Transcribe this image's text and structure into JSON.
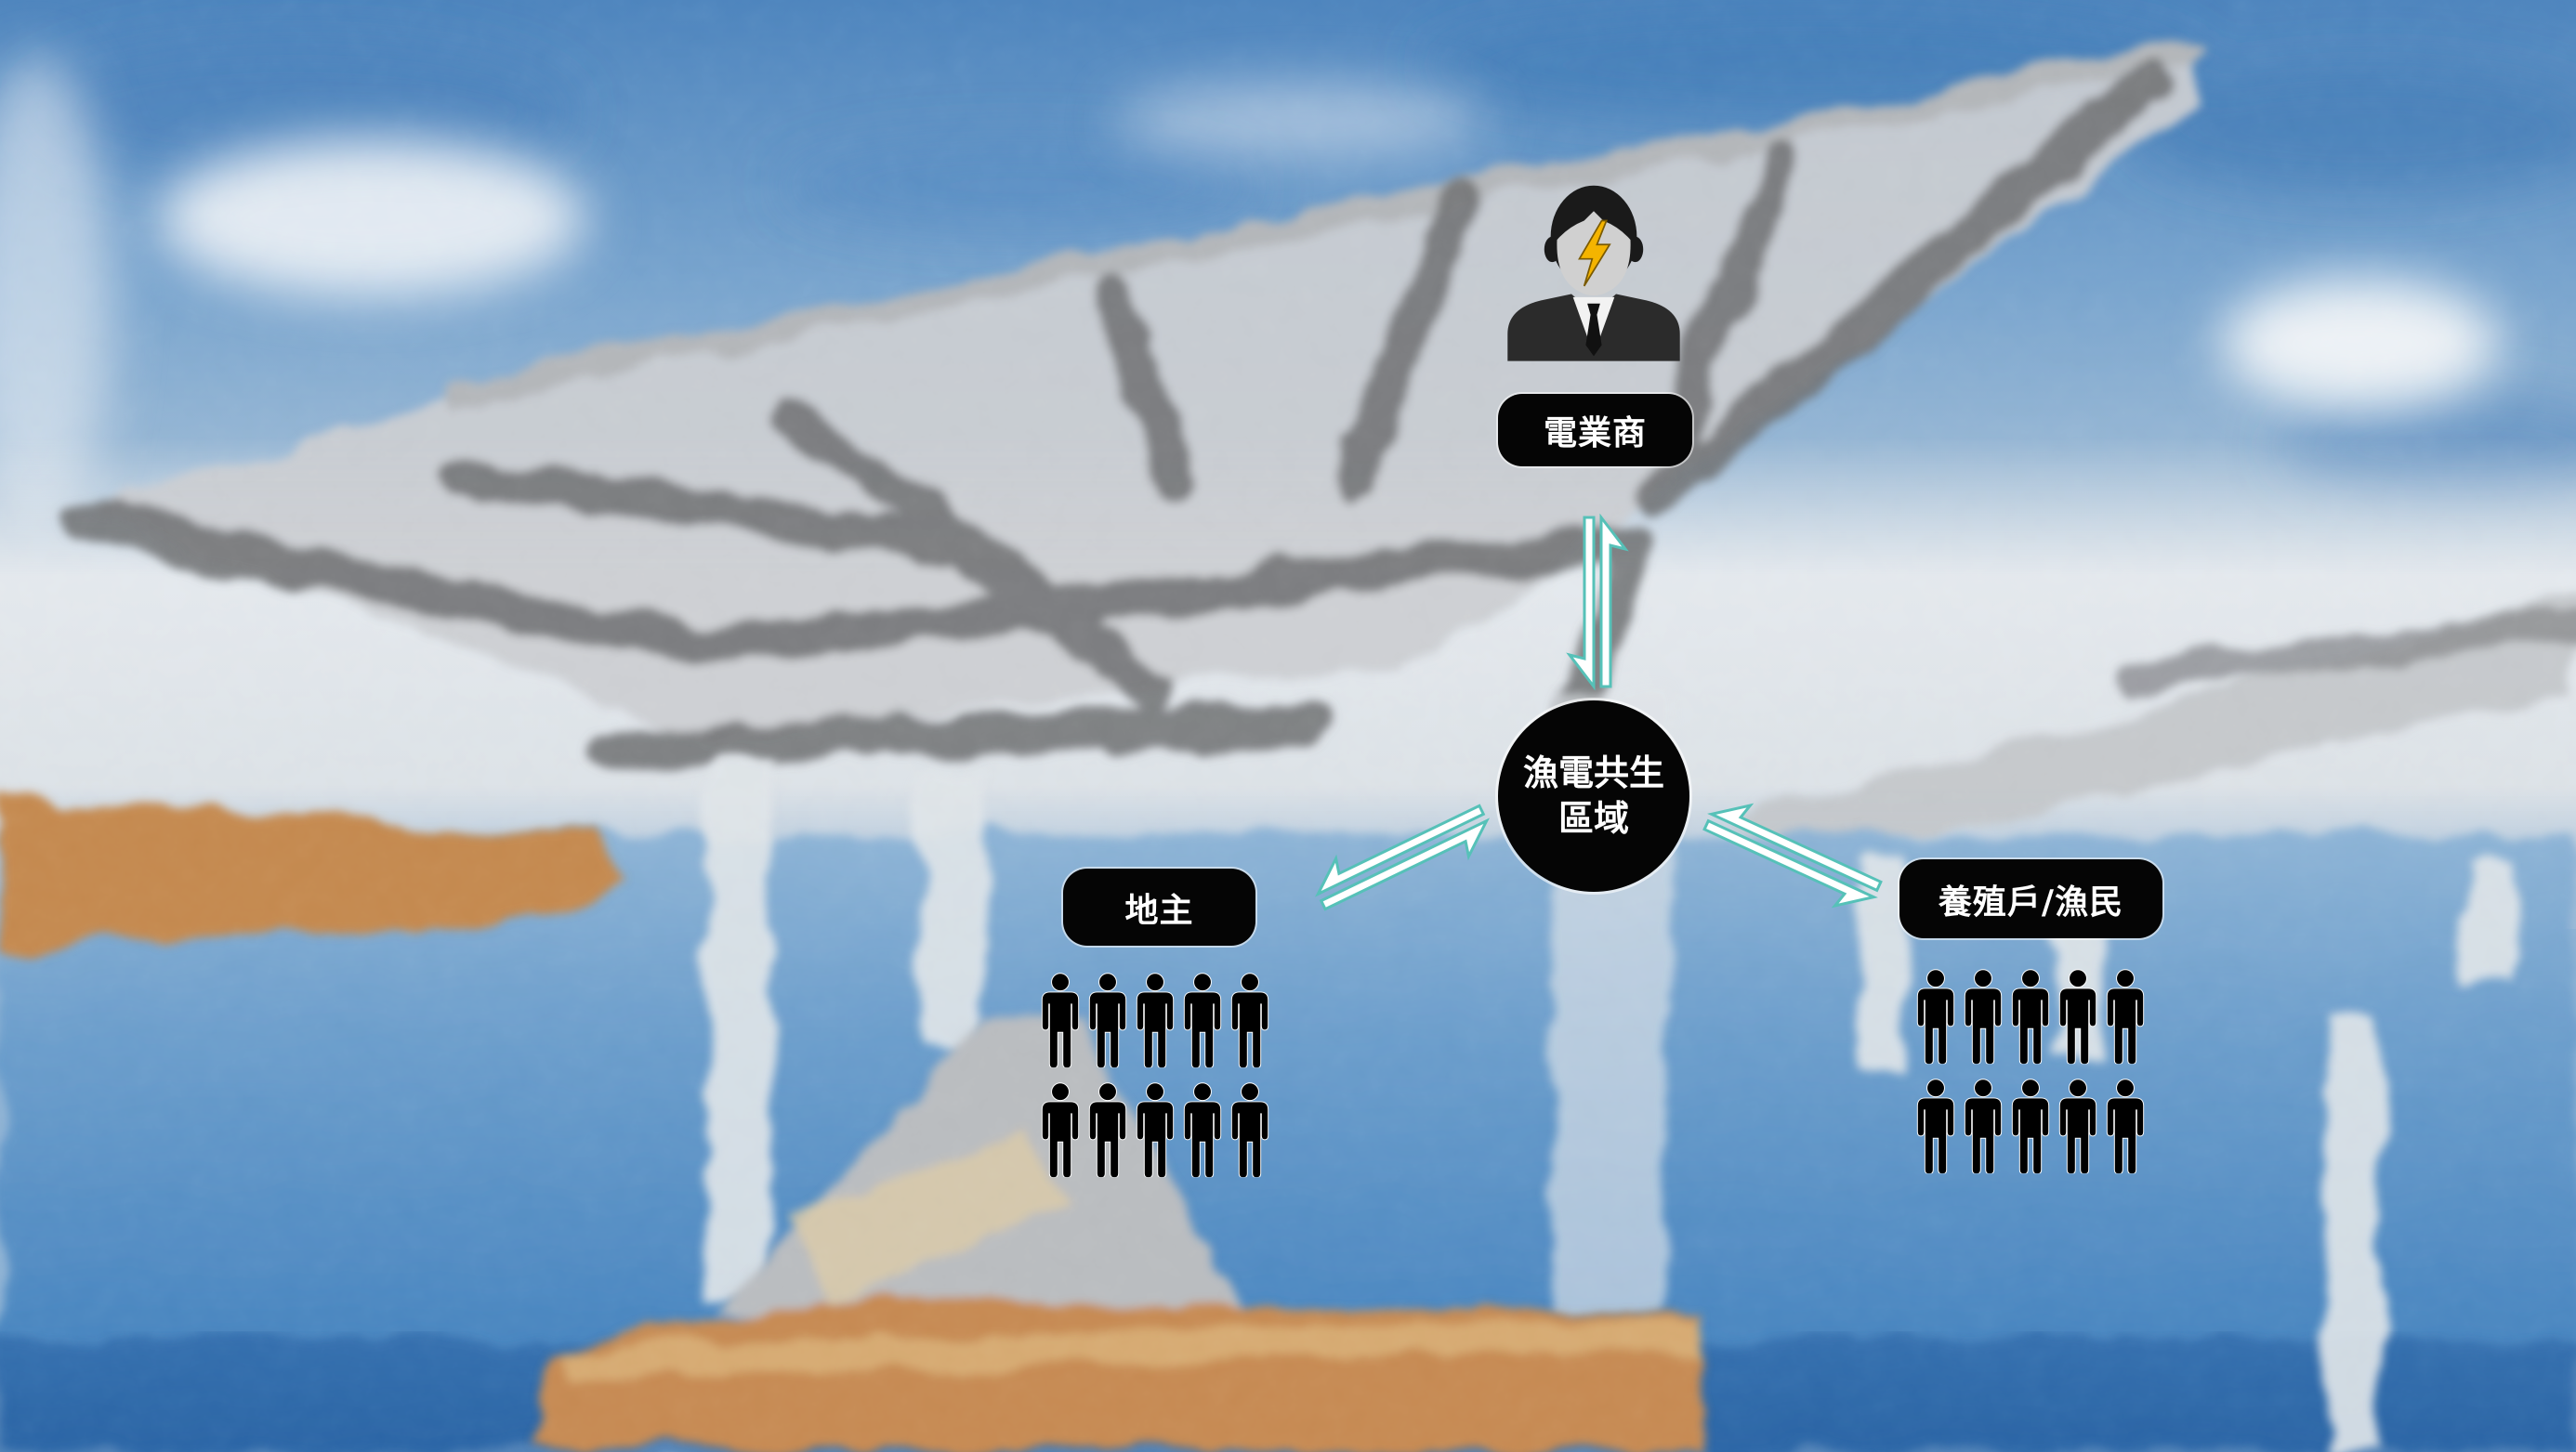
{
  "diagram": {
    "center": {
      "lines": [
        "漁電共生",
        "區域"
      ]
    },
    "top_node": {
      "label": "電業商",
      "icon": "businessman-lightning-icon"
    },
    "left_node": {
      "label": "地主",
      "icon": "person-icon"
    },
    "right_node": {
      "label": "養殖戶/漁民",
      "icon": "person-icon"
    },
    "arrows": {
      "icon": "bidirectional-harpoon-arrow-icon"
    }
  },
  "colors": {
    "node_fill": "#050505",
    "node_text": "#ffffff",
    "arrow_stroke": "#56c1b8",
    "arrow_fill": "#ffffff",
    "bolt": "#f4b400",
    "suit": "#2b2b2b"
  }
}
